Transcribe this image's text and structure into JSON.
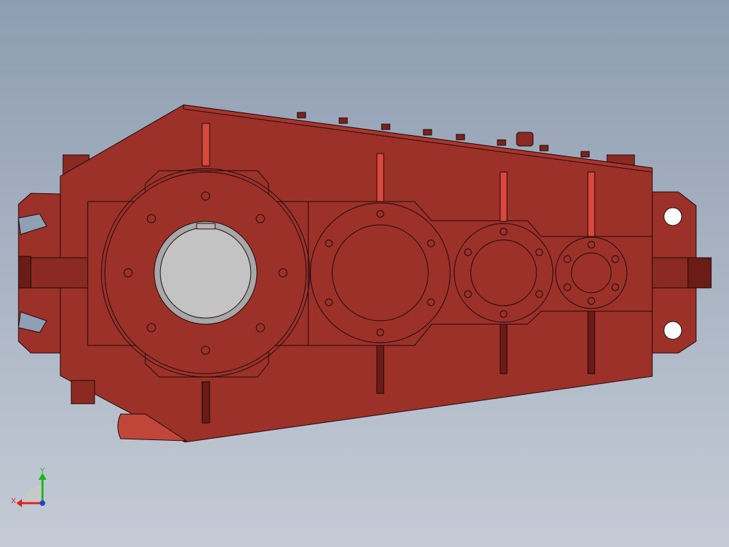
{
  "triad": {
    "x_label": "X",
    "y_label": "Y",
    "x_color": "#e02020",
    "y_color": "#18b818",
    "z_color": "#2040e0"
  },
  "model": {
    "body_color": "#9b3128",
    "dark_color": "#6b1c16",
    "edge_color": "#1a0605",
    "bore_color": "#c3c3c3",
    "highlight_color": "#d8493d"
  },
  "background": {
    "top": "#8e9db2",
    "bottom": "#c4cbd5"
  }
}
